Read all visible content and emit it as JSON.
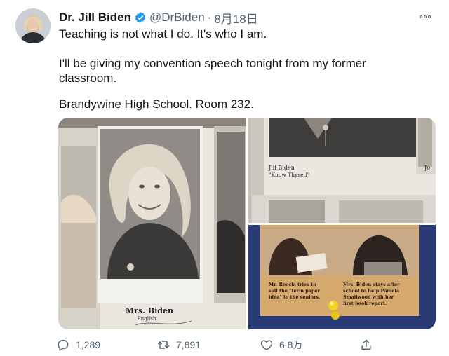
{
  "author": {
    "name": "Dr. Jill Biden",
    "handle": "@DrBiden",
    "separator": "·",
    "date": "8月18日"
  },
  "tweet": {
    "line1": "Teaching is not what I do. It's who I am.",
    "line2": "I'll be giving my convention speech tonight from my former classroom.",
    "line3": "Brandywine High School. Room 232."
  },
  "media": {
    "photo1": {
      "caption_name": "Mrs. Biden",
      "caption_subject": "English"
    },
    "photo2": {
      "name": "Jill Biden",
      "quote": "\"Know Thyself\"",
      "partial": "Jo"
    },
    "photo3": {
      "caption_left": [
        "Mr. Roccia tries to",
        "sell the \"term paper",
        "idea\" to the seniors."
      ],
      "caption_right": [
        "Mrs. Biden stays after",
        "school to help Pamela",
        "Smallwood with her",
        "first book report."
      ]
    }
  },
  "actions": {
    "reply_count": "1,289",
    "retweet_count": "7,891",
    "like_count": "6.8万"
  },
  "colors": {
    "text_primary": "#0f1419",
    "text_secondary": "#536471",
    "verified_blue": "#1d9bf0"
  },
  "icons": [
    "more-icon",
    "verified-badge-icon",
    "reply-icon",
    "retweet-icon",
    "like-icon",
    "share-icon"
  ]
}
